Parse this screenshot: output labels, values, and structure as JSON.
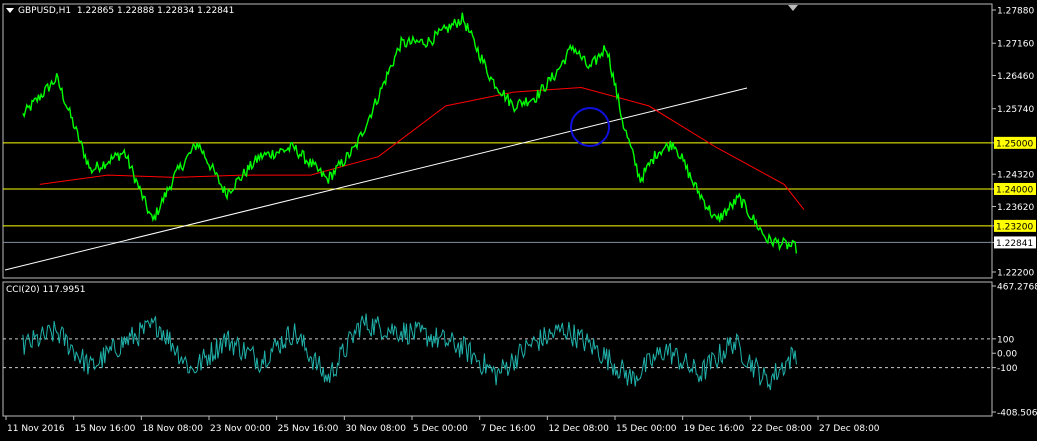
{
  "header": {
    "symbol_timeframe": "GBPUSD,H1",
    "ohlc": "1.22865 1.22888 1.22834 1.22841"
  },
  "indicator": {
    "label": "CCI(20) 117.9951"
  },
  "colors": {
    "background": "#000000",
    "price": "#00ff00",
    "moving_average": "#ff0000",
    "trendline": "#ffffff",
    "support_lines": "#ffff00",
    "highlight_circle": "#1010dd",
    "cci_line": "#20b2aa",
    "current_price_line": "#8090a0"
  },
  "chart_data": [
    {
      "type": "line",
      "title": "GBPUSD,H1",
      "price_ticks": [
        "1.27880",
        "1.27160",
        "1.26460",
        "1.25740",
        "1.25000",
        "1.24320",
        "1.24000",
        "1.23620",
        "1.23200",
        "1.22841",
        "1.22200"
      ],
      "ylim": [
        1.222,
        1.2788
      ],
      "horizontal_lines": [
        {
          "value": 1.25,
          "label": "1.25000"
        },
        {
          "value": 1.24,
          "label": "1.24000"
        },
        {
          "value": 1.232,
          "label": "1.23200"
        }
      ],
      "current_price": {
        "value": 1.22841,
        "label": "1.22841"
      },
      "x_ticks": [
        "11 Nov 2016",
        "15 Nov 16:00",
        "18 Nov 08:00",
        "23 Nov 00:00",
        "25 Nov 16:00",
        "30 Nov 08:00",
        "5 Dec 00:00",
        "7 Dec 16:00",
        "12 Dec 08:00",
        "15 Dec 00:00",
        "19 Dec 16:00",
        "22 Dec 08:00",
        "27 Dec 08:00"
      ],
      "series": [
        {
          "kind": "price",
          "points": [
            {
              "x": "11 Nov 2016",
              "y": 1.256
            },
            {
              "x": "11 Nov 2016",
              "y": 1.264
            },
            {
              "x": "15 Nov 16:00",
              "y": 1.244
            },
            {
              "x": "15 Nov 16:00",
              "y": 1.248
            },
            {
              "x": "18 Nov 08:00",
              "y": 1.233
            },
            {
              "x": "18 Nov 08:00",
              "y": 1.243
            },
            {
              "x": "18 Nov 08:00",
              "y": 1.25
            },
            {
              "x": "23 Nov 00:00",
              "y": 1.239
            },
            {
              "x": "23 Nov 00:00",
              "y": 1.247
            },
            {
              "x": "25 Nov 16:00",
              "y": 1.249
            },
            {
              "x": "25 Nov 16:00",
              "y": 1.242
            },
            {
              "x": "30 Nov 08:00",
              "y": 1.249
            },
            {
              "x": "30 Nov 08:00",
              "y": 1.26
            },
            {
              "x": "30 Nov 08:00",
              "y": 1.2715
            },
            {
              "x": "5 Dec 00:00",
              "y": 1.272
            },
            {
              "x": "5 Dec 00:00",
              "y": 1.277
            },
            {
              "x": "7 Dec 16:00",
              "y": 1.264
            },
            {
              "x": "7 Dec 16:00",
              "y": 1.258
            },
            {
              "x": "7 Dec 16:00",
              "y": 1.26
            },
            {
              "x": "12 Dec 08:00",
              "y": 1.265
            },
            {
              "x": "12 Dec 08:00",
              "y": 1.271
            },
            {
              "x": "12 Dec 08:00",
              "y": 1.266
            },
            {
              "x": "12 Dec 08:00",
              "y": 1.271
            },
            {
              "x": "15 Dec 00:00",
              "y": 1.254
            },
            {
              "x": "15 Dec 00:00",
              "y": 1.242
            },
            {
              "x": "15 Dec 00:00",
              "y": 1.248
            },
            {
              "x": "15 Dec 00:00",
              "y": 1.25
            },
            {
              "x": "19 Dec 16:00",
              "y": 1.241
            },
            {
              "x": "19 Dec 16:00",
              "y": 1.233
            },
            {
              "x": "19 Dec 16:00",
              "y": 1.238
            },
            {
              "x": "22 Dec 08:00",
              "y": 1.229
            },
            {
              "x": "22 Dec 08:00",
              "y": 1.227
            },
            {
              "x": "27 Dec 08:00",
              "y": 1.228
            },
            {
              "x": "27 Dec 08:00",
              "y": 1.2284
            }
          ]
        },
        {
          "kind": "moving_average",
          "points": [
            {
              "x": "11 Nov 2016",
              "y": 1.241
            },
            {
              "x": "15 Nov 16:00",
              "y": 1.243
            },
            {
              "x": "18 Nov 08:00",
              "y": 1.2425
            },
            {
              "x": "23 Nov 00:00",
              "y": 1.243
            },
            {
              "x": "25 Nov 16:00",
              "y": 1.243
            },
            {
              "x": "30 Nov 08:00",
              "y": 1.247
            },
            {
              "x": "5 Dec 00:00",
              "y": 1.258
            },
            {
              "x": "7 Dec 16:00",
              "y": 1.261
            },
            {
              "x": "12 Dec 08:00",
              "y": 1.262
            },
            {
              "x": "15 Dec 00:00",
              "y": 1.258
            },
            {
              "x": "19 Dec 16:00",
              "y": 1.249
            },
            {
              "x": "22 Dec 08:00",
              "y": 1.241
            },
            {
              "x": "27 Dec 08:00",
              "y": 1.2355
            }
          ]
        }
      ]
    },
    {
      "type": "line",
      "title": "CCI(20) 117.9951",
      "ticks": [
        "467.2768",
        "100",
        "0.00",
        "-100",
        "-408.5069"
      ],
      "ylim": [
        -408.5069,
        467.2768
      ],
      "levels": [
        100,
        -100
      ],
      "series": [
        {
          "kind": "cci",
          "points": [
            {
              "x": "11 Nov 2016",
              "y": 50
            },
            {
              "x": "11 Nov 2016",
              "y": 150
            },
            {
              "x": "15 Nov 16:00",
              "y": -100
            },
            {
              "x": "15 Nov 16:00",
              "y": 80
            },
            {
              "x": "18 Nov 08:00",
              "y": 200
            },
            {
              "x": "18 Nov 08:00",
              "y": -120
            },
            {
              "x": "23 Nov 00:00",
              "y": 100
            },
            {
              "x": "23 Nov 00:00",
              "y": -50
            },
            {
              "x": "25 Nov 16:00",
              "y": 150
            },
            {
              "x": "25 Nov 16:00",
              "y": -180
            },
            {
              "x": "30 Nov 08:00",
              "y": 210
            },
            {
              "x": "30 Nov 08:00",
              "y": 160
            },
            {
              "x": "5 Dec 00:00",
              "y": 120
            },
            {
              "x": "5 Dec 00:00",
              "y": 40
            },
            {
              "x": "7 Dec 16:00",
              "y": -150
            },
            {
              "x": "7 Dec 16:00",
              "y": 60
            },
            {
              "x": "12 Dec 08:00",
              "y": 170
            },
            {
              "x": "12 Dec 08:00",
              "y": 20
            },
            {
              "x": "15 Dec 00:00",
              "y": -180
            },
            {
              "x": "15 Dec 00:00",
              "y": 30
            },
            {
              "x": "19 Dec 16:00",
              "y": -150
            },
            {
              "x": "19 Dec 16:00",
              "y": 80
            },
            {
              "x": "22 Dec 08:00",
              "y": -200
            },
            {
              "x": "22 Dec 08:00",
              "y": 40
            },
            {
              "x": "27 Dec 08:00",
              "y": -30
            },
            {
              "x": "27 Dec 08:00",
              "y": 118
            }
          ]
        }
      ]
    }
  ]
}
